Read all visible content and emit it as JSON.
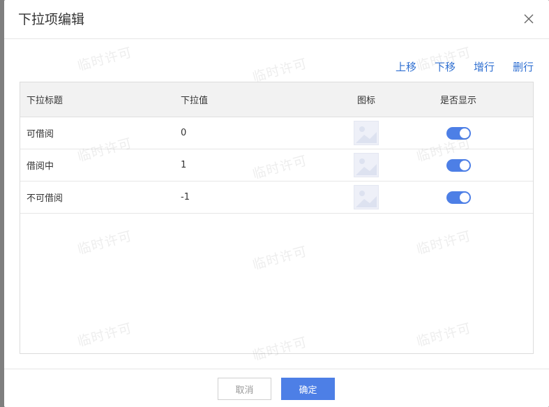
{
  "dialog": {
    "title": "下拉项编辑",
    "close_icon": "close-icon"
  },
  "toolbar": {
    "move_up": "上移",
    "move_down": "下移",
    "add_row": "增行",
    "delete_row": "删行"
  },
  "table": {
    "headers": [
      "下拉标题",
      "下拉值",
      "图标",
      "是否显示"
    ],
    "rows": [
      {
        "title": "可借阅",
        "value": "0",
        "icon": "image-placeholder-icon",
        "visible": true
      },
      {
        "title": "借阅中",
        "value": "1",
        "icon": "image-placeholder-icon",
        "visible": true
      },
      {
        "title": "不可借阅",
        "value": "-1",
        "icon": "image-placeholder-icon",
        "visible": true
      }
    ]
  },
  "footer": {
    "cancel": "取消",
    "ok": "确定"
  },
  "watermark": "临时许可",
  "colors": {
    "accent": "#4d7fe6",
    "link": "#2f6fd1"
  }
}
